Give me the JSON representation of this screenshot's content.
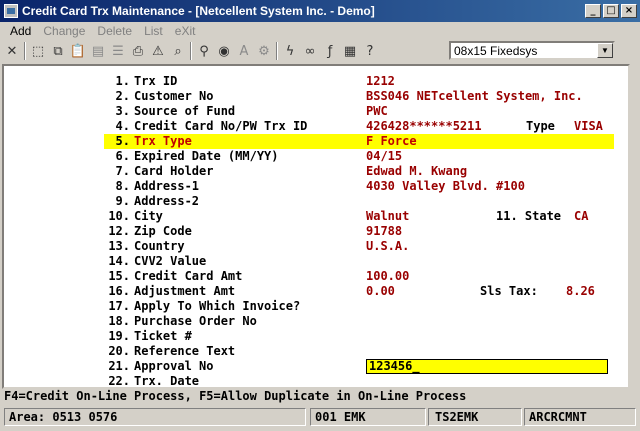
{
  "window": {
    "title": "Credit Card Trx Maintenance - [Netcellent System Inc. - Demo]",
    "min_glyph": "_",
    "max_glyph": "□",
    "close_glyph": "×"
  },
  "menu": [
    {
      "label": "Add",
      "enabled": true
    },
    {
      "label": "Change",
      "enabled": false
    },
    {
      "label": "Delete",
      "enabled": false
    },
    {
      "label": "List",
      "enabled": false
    },
    {
      "label": "eXit",
      "enabled": false
    }
  ],
  "toolbar": {
    "buttons": [
      {
        "name": "cancel-icon",
        "glyph": "✕"
      },
      {
        "name": "select-icon",
        "glyph": "⬚"
      },
      {
        "name": "copy-icon",
        "glyph": "⧉"
      },
      {
        "name": "paste-icon",
        "glyph": "📋"
      },
      {
        "name": "clipboard-icon",
        "glyph": "▤"
      },
      {
        "name": "notes-icon",
        "glyph": "☰"
      },
      {
        "name": "print-icon",
        "glyph": "⎙"
      },
      {
        "name": "alert-icon",
        "glyph": "⚠"
      },
      {
        "name": "binoculars-icon",
        "glyph": "⌕"
      },
      {
        "name": "zoom-icon",
        "glyph": "⚲"
      },
      {
        "name": "globe-icon",
        "glyph": "◉"
      },
      {
        "name": "font-icon",
        "glyph": "A"
      },
      {
        "name": "tools-icon",
        "glyph": "⚙"
      },
      {
        "name": "lightning-icon",
        "glyph": "ϟ"
      },
      {
        "name": "link-icon",
        "glyph": "∞"
      },
      {
        "name": "function-icon",
        "glyph": "ƒ"
      },
      {
        "name": "calculator-icon",
        "glyph": "▦"
      },
      {
        "name": "help-pointer-icon",
        "glyph": "?"
      }
    ],
    "font_select": "08x15 Fixedsys"
  },
  "fields": [
    {
      "num": "1.",
      "label": "Trx ID",
      "value": "1212"
    },
    {
      "num": "2.",
      "label": "Customer No",
      "value": "BSS046 NETcellent System, Inc."
    },
    {
      "num": "3.",
      "label": "Source of Fund",
      "value": "PWC"
    },
    {
      "num": "4.",
      "label": "Credit Card No/PW Trx ID",
      "value": "426428******5211",
      "tail_label": "Type",
      "tail_value": "VISA"
    },
    {
      "num": "5.",
      "label": "Trx Type",
      "value": "F Force",
      "highlight": true
    },
    {
      "num": "6.",
      "label": "Expired Date (MM/YY)",
      "value": "04/15"
    },
    {
      "num": "7.",
      "label": "Card Holder",
      "value": "Edwad M. Kwang"
    },
    {
      "num": "8.",
      "label": "Address-1",
      "value": "4030 Valley Blvd. #100"
    },
    {
      "num": "9.",
      "label": "Address-2",
      "value": ""
    },
    {
      "num": "10.",
      "label": "City",
      "value": "Walnut",
      "tail_label": "11. State",
      "tail_value": "CA"
    },
    {
      "num": "12.",
      "label": "Zip Code",
      "value": "91788"
    },
    {
      "num": "13.",
      "label": "Country",
      "value": "U.S.A."
    },
    {
      "num": "14.",
      "label": "CVV2 Value",
      "value": ""
    },
    {
      "num": "15.",
      "label": "Credit Card Amt",
      "value": "100.00"
    },
    {
      "num": "16.",
      "label": "Adjustment Amt",
      "value": "0.00",
      "tail_label": "Sls Tax:",
      "tail_value": "8.26"
    },
    {
      "num": "17.",
      "label": "Apply To Which Invoice?",
      "value": ""
    },
    {
      "num": "18.",
      "label": "Purchase Order No",
      "value": ""
    },
    {
      "num": "19.",
      "label": "Ticket #",
      "value": ""
    },
    {
      "num": "20.",
      "label": "Reference Text",
      "value": ""
    },
    {
      "num": "21.",
      "label": "Approval No",
      "value": "123456_",
      "input": true
    },
    {
      "num": "22.",
      "label": "Trx. Date",
      "value": ""
    }
  ],
  "function_keys": "F4=Credit On-Line Process, F5=Allow Duplicate in On-Line Process",
  "status": {
    "area": "Area: 0513 0576",
    "company": "001 EMK",
    "user": "TS2EMK",
    "program": "ARCRCMNT"
  }
}
